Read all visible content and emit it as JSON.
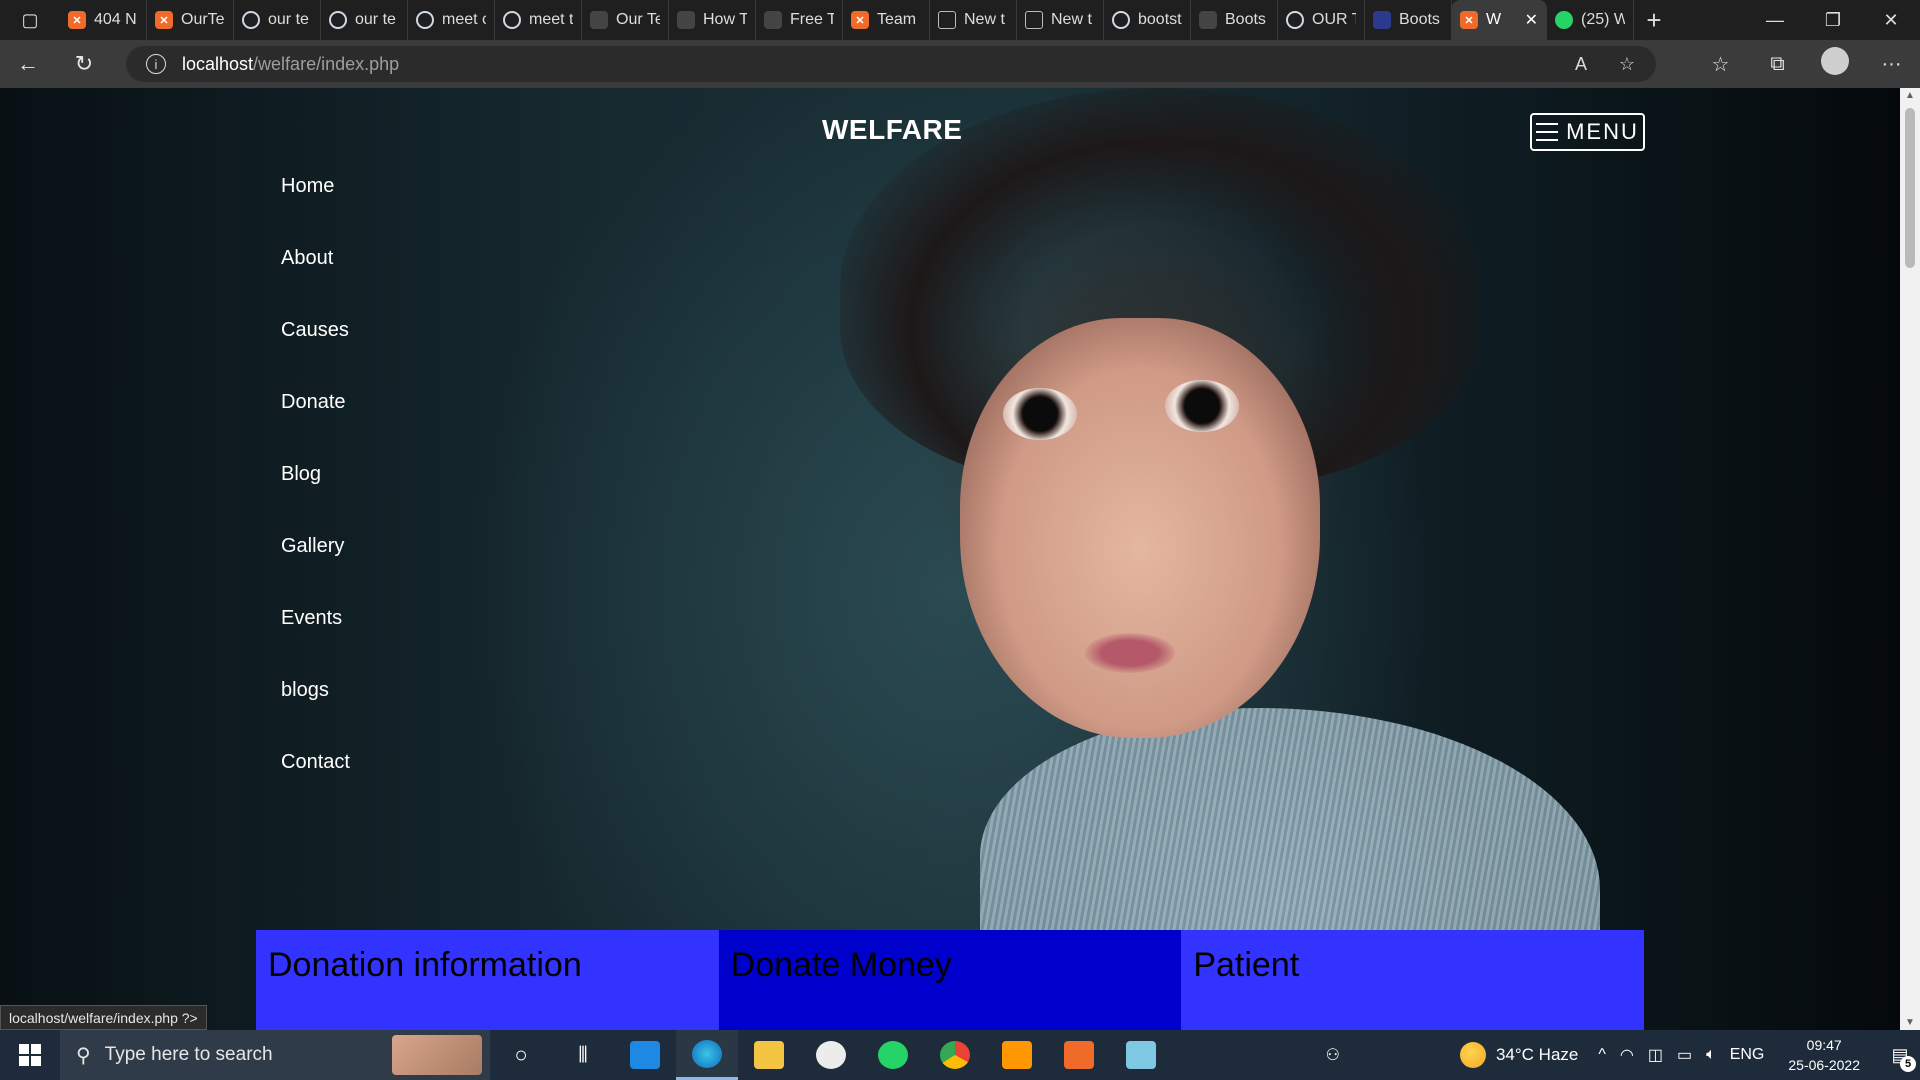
{
  "browser": {
    "tabs": [
      {
        "label": "404 N",
        "icon": "xampp-icon"
      },
      {
        "label": "OurTe",
        "icon": "xampp-icon"
      },
      {
        "label": "our te",
        "icon": "search-icon"
      },
      {
        "label": "our te",
        "icon": "search-icon"
      },
      {
        "label": "meet c",
        "icon": "search-icon"
      },
      {
        "label": "meet t",
        "icon": "search-icon"
      },
      {
        "label": "Our Te",
        "icon": "page-icon"
      },
      {
        "label": "How T",
        "icon": "page-icon"
      },
      {
        "label": "Free Te",
        "icon": "page-icon"
      },
      {
        "label": "Team",
        "icon": "xampp-icon"
      },
      {
        "label": "New t",
        "icon": "newtab-icon"
      },
      {
        "label": "New t",
        "icon": "newtab-icon"
      },
      {
        "label": "bootst",
        "icon": "search-icon"
      },
      {
        "label": "Boots",
        "icon": "page-icon"
      },
      {
        "label": "OUR T",
        "icon": "search-icon"
      },
      {
        "label": "Boots",
        "icon": "page-icon"
      },
      {
        "label": "W",
        "icon": "xampp-icon",
        "active": true
      },
      {
        "label": "(25) W",
        "icon": "whatsapp-icon"
      }
    ],
    "url_host": "localhost",
    "url_path": "/welfare/index.php",
    "status_url": "localhost/welfare/index.php ?>"
  },
  "page": {
    "brand": "WELFARE",
    "menu_label": "MENU",
    "nav": [
      "Home",
      "About",
      "Causes",
      "Donate",
      "Blog",
      "Gallery",
      "Events",
      "blogs",
      "Contact"
    ],
    "cards": [
      "Donation information",
      "Donate Money",
      "Patient"
    ],
    "colors": {
      "card": "#3333ff",
      "card_mid": "#0000cc"
    }
  },
  "taskbar": {
    "search_placeholder": "Type here to search",
    "weather": "34°C  Haze",
    "language": "ENG",
    "time": "09:47",
    "date": "25-06-2022",
    "notifications": "5"
  }
}
